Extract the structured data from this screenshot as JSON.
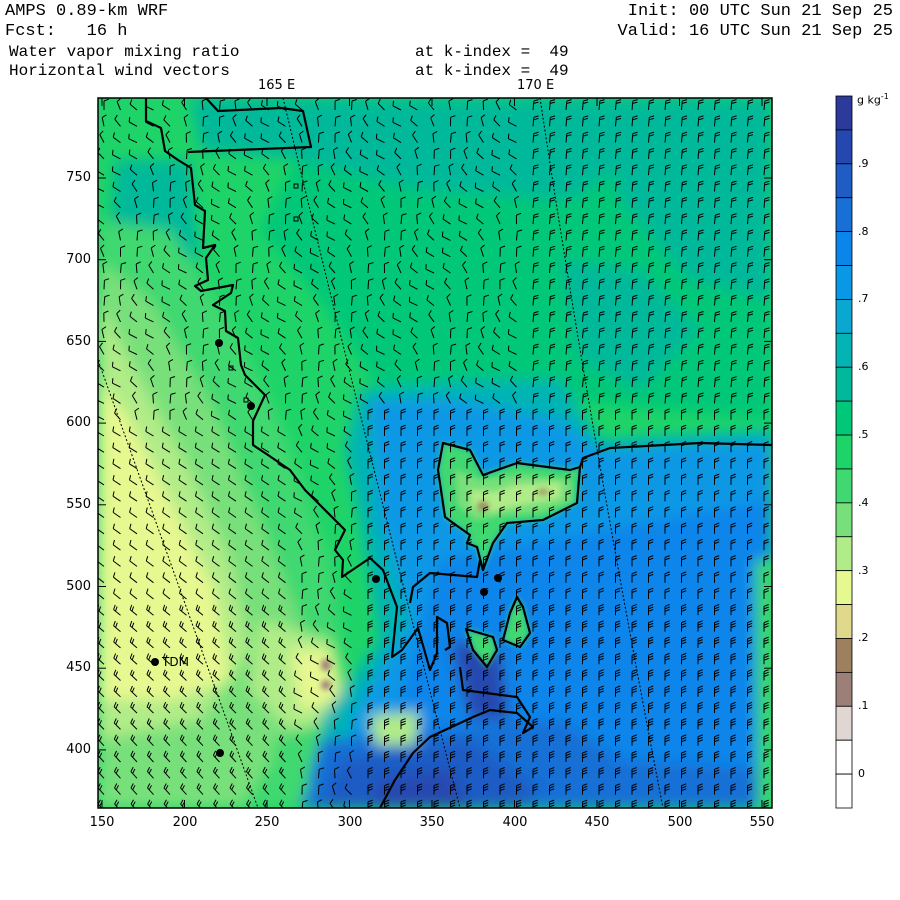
{
  "header": {
    "model": "AMPS 0.89-km WRF",
    "forecast": "Fcst:   16 h",
    "init": "Init: 00 UTC Sun 21 Sep 25",
    "valid": "Valid: 16 UTC Sun 21 Sep 25",
    "field1": "Water vapor mixing ratio",
    "field1_level": "at k-index =  49",
    "field2": "Horizontal wind vectors",
    "field2_level": "at k-index =  49"
  },
  "map": {
    "longitude_labels": [
      "165 E",
      "170 E"
    ],
    "x_ticks": [
      "150",
      "200",
      "250",
      "300",
      "350",
      "400",
      "450",
      "500",
      "550"
    ],
    "y_ticks": [
      "750",
      "700",
      "650",
      "600",
      "550",
      "500",
      "450",
      "400"
    ],
    "station_label": "TDM"
  },
  "colorbar": {
    "units": "g kg",
    "units_exp": "-1",
    "labels": [
      ".9",
      ".8",
      ".7",
      ".6",
      ".5",
      ".4",
      ".3",
      ".2",
      ".1",
      "0"
    ],
    "colors": [
      "#2b3a9b",
      "#2548b0",
      "#1f5cc4",
      "#1870d6",
      "#0a85ea",
      "#0898e6",
      "#0aa8d0",
      "#04b4b4",
      "#00b99a",
      "#00c878",
      "#1ed468",
      "#40d870",
      "#78e07a",
      "#b0ec88",
      "#e6f890",
      "#e0d88a",
      "#9c8060",
      "#9c8078",
      "#e0d6d2",
      "#ffffff",
      "#ffffff"
    ]
  }
}
